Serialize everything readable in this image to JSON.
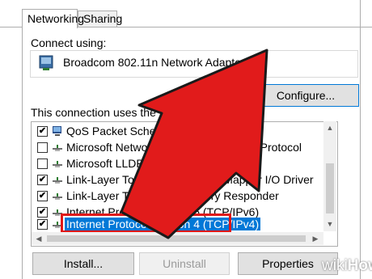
{
  "tabs": [
    {
      "label": "Networking"
    },
    {
      "label": "Sharing"
    }
  ],
  "connect_using": {
    "label": "Connect using:",
    "adapter": "Broadcom 802.11n Network Adapter",
    "configure_button": "Configure..."
  },
  "components": {
    "label": "This connection uses the following items:",
    "items": [
      {
        "label": "QoS Packet Scheduler",
        "checked": true,
        "icon": "network-service-icon"
      },
      {
        "label": "Microsoft Network Adapter Multiplexor Protocol",
        "checked": false,
        "icon": "protocol-icon"
      },
      {
        "label": "Microsoft LLDP Protocol Driver",
        "checked": false,
        "icon": "protocol-icon"
      },
      {
        "label": "Link-Layer Topology Discovery Mapper I/O Driver",
        "checked": true,
        "icon": "protocol-icon"
      },
      {
        "label": "Link-Layer Topology Discovery Responder",
        "checked": true,
        "icon": "protocol-icon"
      },
      {
        "label": "Internet Protocol Version 6 (TCP/IPv6)",
        "checked": true,
        "icon": "protocol-icon"
      },
      {
        "label": "Internet Protocol Version 4 (TCP/IPv4)",
        "checked": true,
        "icon": "protocol-icon",
        "selected": true
      }
    ]
  },
  "buttons": {
    "install": "Install...",
    "uninstall": "Uninstall",
    "properties": "Properties"
  },
  "colors": {
    "selection": "#0078d7",
    "highlight_box": "#e01818",
    "arrow": "#e11b1b"
  },
  "watermark": {
    "part1": "wiki",
    "part2": "How"
  }
}
